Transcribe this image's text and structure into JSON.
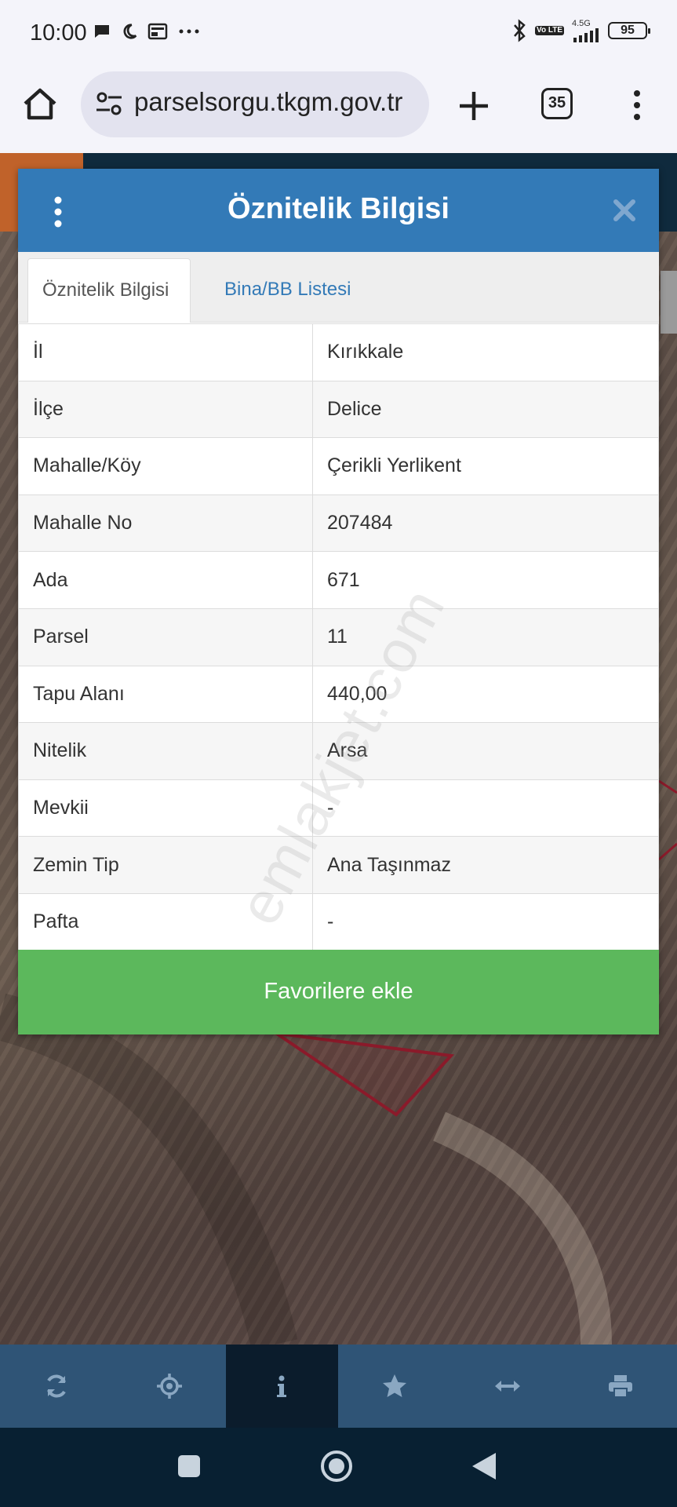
{
  "status_bar": {
    "time": "10:00",
    "network": "4.5G",
    "volte": "Vo LTE",
    "battery": "95"
  },
  "browser": {
    "url": "parselsorgu.tkgm.gov.tr",
    "tab_count": "35"
  },
  "dialog": {
    "title": "Öznitelik Bilgisi",
    "tabs": [
      {
        "label": "Öznitelik Bilgisi",
        "active": true
      },
      {
        "label": "Bina/BB Listesi",
        "active": false
      }
    ],
    "rows": [
      {
        "key": "İl",
        "value": "Kırıkkale"
      },
      {
        "key": "İlçe",
        "value": "Delice"
      },
      {
        "key": "Mahalle/Köy",
        "value": "Çerikli Yerlikent"
      },
      {
        "key": "Mahalle No",
        "value": "207484"
      },
      {
        "key": "Ada",
        "value": "671"
      },
      {
        "key": "Parsel",
        "value": "11"
      },
      {
        "key": "Tapu Alanı",
        "value": "440,00"
      },
      {
        "key": "Nitelik",
        "value": "Arsa"
      },
      {
        "key": "Mevkii",
        "value": "-"
      },
      {
        "key": "Zemin Tip",
        "value": "Ana Taşınmaz"
      },
      {
        "key": "Pafta",
        "value": "-"
      }
    ],
    "favorite_button": "Favorilere ekle"
  },
  "watermark": "emlakjet.com",
  "toolbar": {
    "items": [
      {
        "icon": "refresh-icon",
        "active": false
      },
      {
        "icon": "locate-icon",
        "active": false
      },
      {
        "icon": "info-icon",
        "active": true
      },
      {
        "icon": "star-icon",
        "active": false
      },
      {
        "icon": "measure-icon",
        "active": false
      },
      {
        "icon": "print-icon",
        "active": false
      }
    ]
  },
  "colors": {
    "header_blue": "#337ab7",
    "favorite_green": "#5cb85c",
    "toolbar_blue": "#2f5476",
    "parcel_outline": "#8b1a2a"
  }
}
